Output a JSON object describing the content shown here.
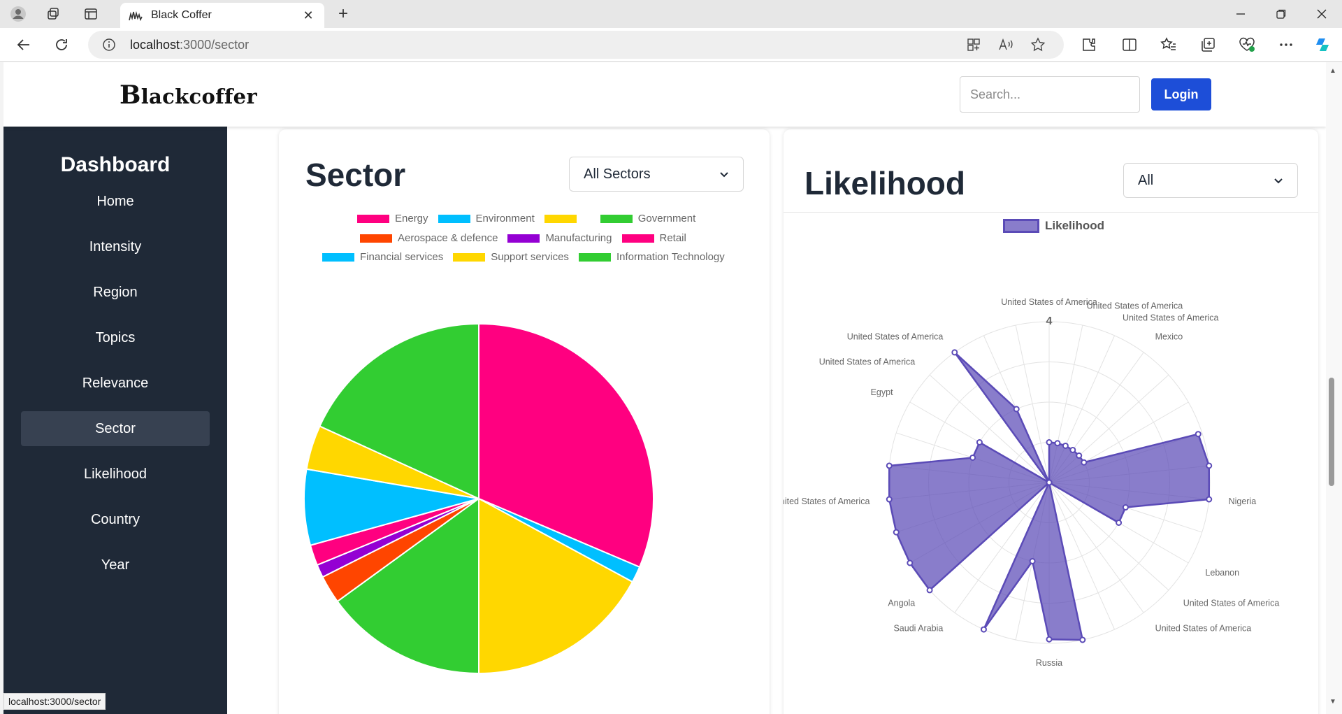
{
  "browser": {
    "tab_title": "Black Coffer",
    "url_host": "localhost",
    "url_path": ":3000/sector",
    "status_url": "localhost:3000/sector"
  },
  "header": {
    "logo_initial": "B",
    "logo_rest": "lackcoffer",
    "search_placeholder": "Search...",
    "login_label": "Login"
  },
  "sidebar": {
    "title": "Dashboard",
    "items": [
      {
        "label": "Home"
      },
      {
        "label": "Intensity"
      },
      {
        "label": "Region"
      },
      {
        "label": "Topics"
      },
      {
        "label": "Relevance"
      },
      {
        "label": "Sector",
        "active": true
      },
      {
        "label": "Likelihood"
      },
      {
        "label": "Country"
      },
      {
        "label": "Year"
      }
    ]
  },
  "sector_card": {
    "title": "Sector",
    "select_value": "All Sectors"
  },
  "likelihood_card": {
    "title": "Likelihood",
    "select_value": "All"
  },
  "chart_data": [
    {
      "type": "pie",
      "legend": [
        {
          "label": "Energy",
          "color": "#ff0080"
        },
        {
          "label": "Environment",
          "color": "#00bfff"
        },
        {
          "label": "",
          "color": "#ffd700"
        },
        {
          "label": "Government",
          "color": "#32cd32"
        },
        {
          "label": "Aerospace & defence",
          "color": "#ff4500"
        },
        {
          "label": "Manufacturing",
          "color": "#9400d3"
        },
        {
          "label": "Retail",
          "color": "#ff0080"
        },
        {
          "label": "Financial services",
          "color": "#00bfff"
        },
        {
          "label": "Support services",
          "color": "#ffd700"
        },
        {
          "label": "Information Technology",
          "color": "#32cd32"
        }
      ],
      "slices": [
        {
          "label": "Energy",
          "value": 31.4,
          "color": "#ff0080"
        },
        {
          "label": "Environment",
          "value": 1.5,
          "color": "#00bfff"
        },
        {
          "label": "",
          "value": 17.1,
          "color": "#ffd700"
        },
        {
          "label": "Government",
          "value": 15.0,
          "color": "#32cd32"
        },
        {
          "label": "Aerospace & defence",
          "value": 2.6,
          "color": "#ff4500"
        },
        {
          "label": "Manufacturing",
          "value": 1.2,
          "color": "#9400d3"
        },
        {
          "label": "Retail",
          "value": 1.9,
          "color": "#ff0080"
        },
        {
          "label": "Financial services",
          "value": 7.0,
          "color": "#00bfff"
        },
        {
          "label": "Support services",
          "value": 4.1,
          "color": "#ffd700"
        },
        {
          "label": "Information Technology",
          "value": 18.2,
          "color": "#32cd32"
        }
      ]
    },
    {
      "type": "radar",
      "series_name": "Likelihood",
      "color": "#5b4bb7",
      "fill": "rgba(91,75,183,0.72)",
      "r_max": 4,
      "tick_label": "4",
      "points": [
        {
          "label": "United States of America",
          "value": 1.0
        },
        {
          "label": "United States of America",
          "value": 1.0
        },
        {
          "label": "United States of America",
          "value": 1.0
        },
        {
          "label": "Mexico",
          "value": 1.0
        },
        {
          "label": "",
          "value": 1.0
        },
        {
          "label": "",
          "value": 1.0
        },
        {
          "label": "",
          "value": 3.9
        },
        {
          "label": "",
          "value": 4.0
        },
        {
          "label": "Nigeria",
          "value": 4.0
        },
        {
          "label": "",
          "value": 2.0
        },
        {
          "label": "Lebanon",
          "value": 2.0
        },
        {
          "label": "United States of America",
          "value": 0.0
        },
        {
          "label": "United States of America",
          "value": 0.0
        },
        {
          "label": "",
          "value": 0.0
        },
        {
          "label": "",
          "value": 4.0
        },
        {
          "label": "Russia",
          "value": 3.9
        },
        {
          "label": "",
          "value": 2.0
        },
        {
          "label": "",
          "value": 4.0
        },
        {
          "label": "Saudi Arabia",
          "value": 0.0
        },
        {
          "label": "Angola",
          "value": 4.0
        },
        {
          "label": "",
          "value": 4.0
        },
        {
          "label": "",
          "value": 4.0
        },
        {
          "label": "United States of America",
          "value": 4.0
        },
        {
          "label": "",
          "value": 4.0
        },
        {
          "label": "",
          "value": 2.0
        },
        {
          "label": "Egypt",
          "value": 2.0
        },
        {
          "label": "United States of America",
          "value": 0.0
        },
        {
          "label": "United States of America",
          "value": 4.0
        },
        {
          "label": "",
          "value": 2.0
        },
        {
          "label": "",
          "value": 0.0
        }
      ]
    }
  ]
}
